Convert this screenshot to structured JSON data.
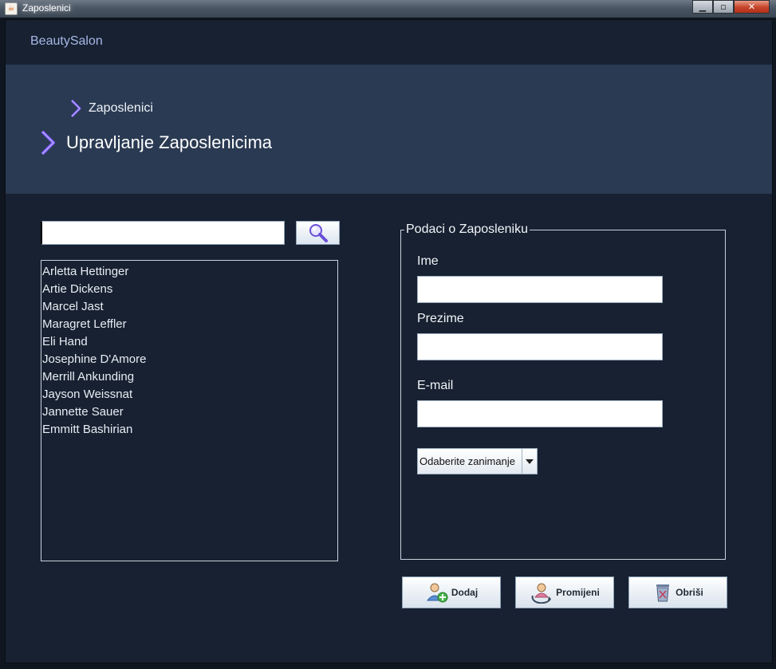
{
  "window": {
    "title": "Zaposlenici"
  },
  "brand": "BeautySalon",
  "breadcrumb": "Zaposlenici",
  "page_title": "Upravljanje Zaposlenicima",
  "search": {
    "value": ""
  },
  "employees": [
    "Arletta Hettinger",
    "Artie Dickens",
    "Marcel Jast",
    "Maragret Leffler",
    "Eli Hand",
    "Josephine D'Amore",
    "Merrill Ankunding",
    "Jayson Weissnat",
    "Jannette Sauer",
    "Emmitt Bashirian"
  ],
  "form": {
    "legend": "Podaci o Zaposleniku",
    "first_name_label": "Ime",
    "last_name_label": "Prezime",
    "email_label": "E-mail",
    "occupation_select": "Odaberite zanimanje"
  },
  "actions": {
    "add": "Dodaj",
    "edit": "Promijeni",
    "delete": "Obriši"
  },
  "colors": {
    "frame": "#172131",
    "header": "#2a3a52",
    "brand": "#a6b8e8",
    "chevron": "#7b5cff"
  }
}
